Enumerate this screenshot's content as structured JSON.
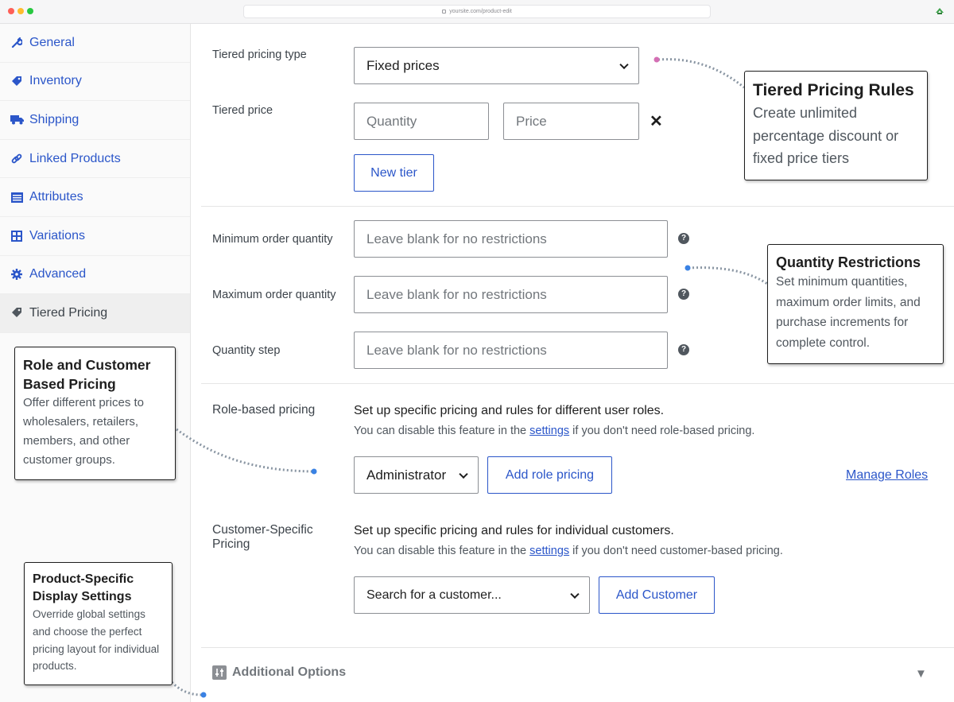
{
  "browser": {
    "url": "yoursite.com/product-edit"
  },
  "sidebar": {
    "items": [
      {
        "label": "General",
        "icon": "wrench-icon"
      },
      {
        "label": "Inventory",
        "icon": "tag-icon"
      },
      {
        "label": "Shipping",
        "icon": "truck-icon"
      },
      {
        "label": "Linked Products",
        "icon": "link-icon"
      },
      {
        "label": "Attributes",
        "icon": "list-icon"
      },
      {
        "label": "Variations",
        "icon": "grid-icon"
      },
      {
        "label": "Advanced",
        "icon": "gear-icon"
      },
      {
        "label": "Tiered Pricing",
        "icon": "price-tag-icon",
        "active": true
      }
    ]
  },
  "tiered": {
    "type_label": "Tiered pricing type",
    "type_value": "Fixed prices",
    "price_label": "Tiered price",
    "quantity_placeholder": "Quantity",
    "price_placeholder": "Price",
    "remove_symbol": "✕",
    "new_tier": "New tier"
  },
  "quantity": {
    "min_label": "Minimum order quantity",
    "max_label": "Maximum order quantity",
    "step_label": "Quantity step",
    "placeholder": "Leave blank for no restrictions",
    "help": "?"
  },
  "role": {
    "label": "Role-based pricing",
    "desc": "Set up specific pricing and rules for different user roles.",
    "sub_pre": "You can disable this feature in the ",
    "sub_link": "settings",
    "sub_post": " if you don't need role-based pricing.",
    "select_value": "Administrator",
    "add_button": "Add role pricing",
    "manage_link": "Manage Roles"
  },
  "customer": {
    "label_line1": "Customer-Specific",
    "label_line2": "Pricing",
    "desc": "Set up specific pricing and rules for individual customers.",
    "sub_pre": "You can disable this feature in the ",
    "sub_link": "settings",
    "sub_post": " if you don't need customer-based pricing.",
    "search_placeholder": "Search for a customer...",
    "add_button": "Add Customer"
  },
  "additional": {
    "label": "Additional Options",
    "toggle": "▼"
  },
  "callouts": {
    "tiered": {
      "title": "Tiered Pricing Rules",
      "body": "Create unlimited percentage discount or fixed price tiers"
    },
    "quantity": {
      "title": "Quantity Restrictions",
      "body": "Set minimum quantities, maximum order limits, and purchase increments for complete control."
    },
    "role": {
      "title": "Role and Customer Based Pricing",
      "body": "Offer different prices to wholesalers, retailers, members, and other customer groups."
    },
    "display": {
      "title": "Product-Specific Display Settings",
      "body": "Override global settings and choose the perfect pricing layout for individual products."
    }
  },
  "colors": {
    "accent": "#2b56c9",
    "dot_pink": "#d46fb4",
    "dot_blue": "#3a82e4",
    "dotted_line": "#8a96a3"
  }
}
